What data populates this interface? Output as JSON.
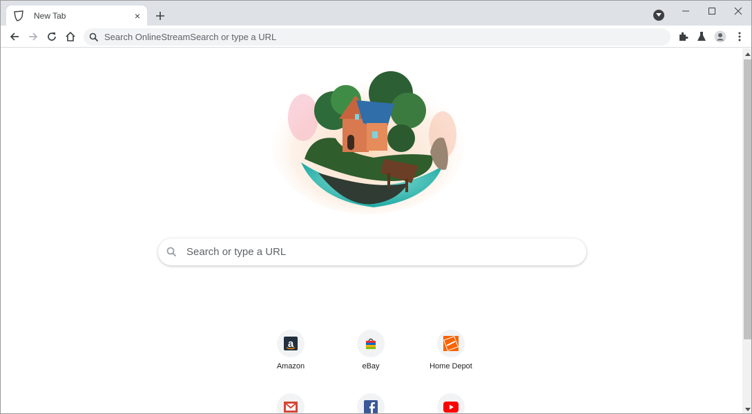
{
  "browser": {
    "tab": {
      "title": "New Tab",
      "close_glyph": "×"
    },
    "new_tab_glyph": "+",
    "omnibox": {
      "placeholder": "Search OnlineStreamSearch or type a URL"
    }
  },
  "page": {
    "search": {
      "placeholder": "Search or type a URL"
    },
    "tiles": [
      {
        "label": "Amazon",
        "icon": "amazon-icon"
      },
      {
        "label": "eBay",
        "icon": "ebay-icon"
      },
      {
        "label": "Home Depot",
        "icon": "home-depot-icon"
      },
      {
        "label": "",
        "icon": "gmail-icon"
      },
      {
        "label": "",
        "icon": "facebook-icon"
      },
      {
        "label": "",
        "icon": "youtube-icon"
      }
    ]
  },
  "colors": {
    "tabstrip": "#dee1e6",
    "omnibox": "#f1f3f4",
    "amazon": "#232f3e",
    "home_depot": "#f96302",
    "gmail": "#d44638",
    "facebook": "#3b5998",
    "youtube": "#ff0000"
  }
}
